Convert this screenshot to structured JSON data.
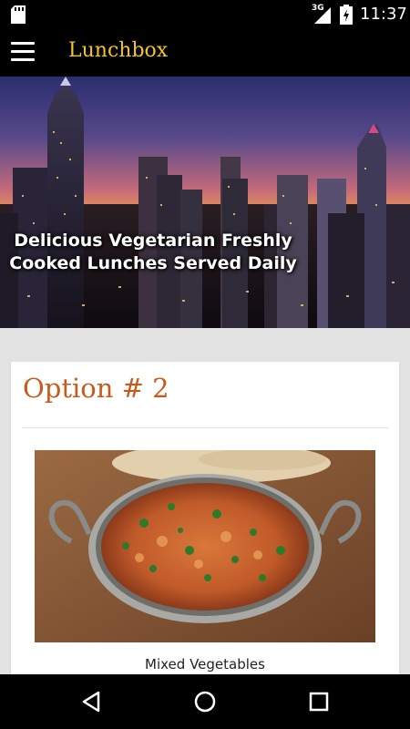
{
  "status_bar": {
    "network": "3G",
    "time": "11:37",
    "icons": [
      "sd-card-icon",
      "signal-icon",
      "battery-icon"
    ]
  },
  "app_bar": {
    "title": "Lunchbox",
    "title_color": "#f2c230",
    "menu_icon": "hamburger-menu-icon"
  },
  "hero": {
    "tagline": "Delicious Vegetarian Freshly Cooked Lunches Served Daily"
  },
  "card": {
    "title": "Option # 2",
    "title_color": "#c85a1e",
    "dish_caption": "Mixed Vegetables"
  },
  "nav_bar": {
    "buttons": [
      "back-icon",
      "home-icon",
      "recents-icon"
    ]
  }
}
